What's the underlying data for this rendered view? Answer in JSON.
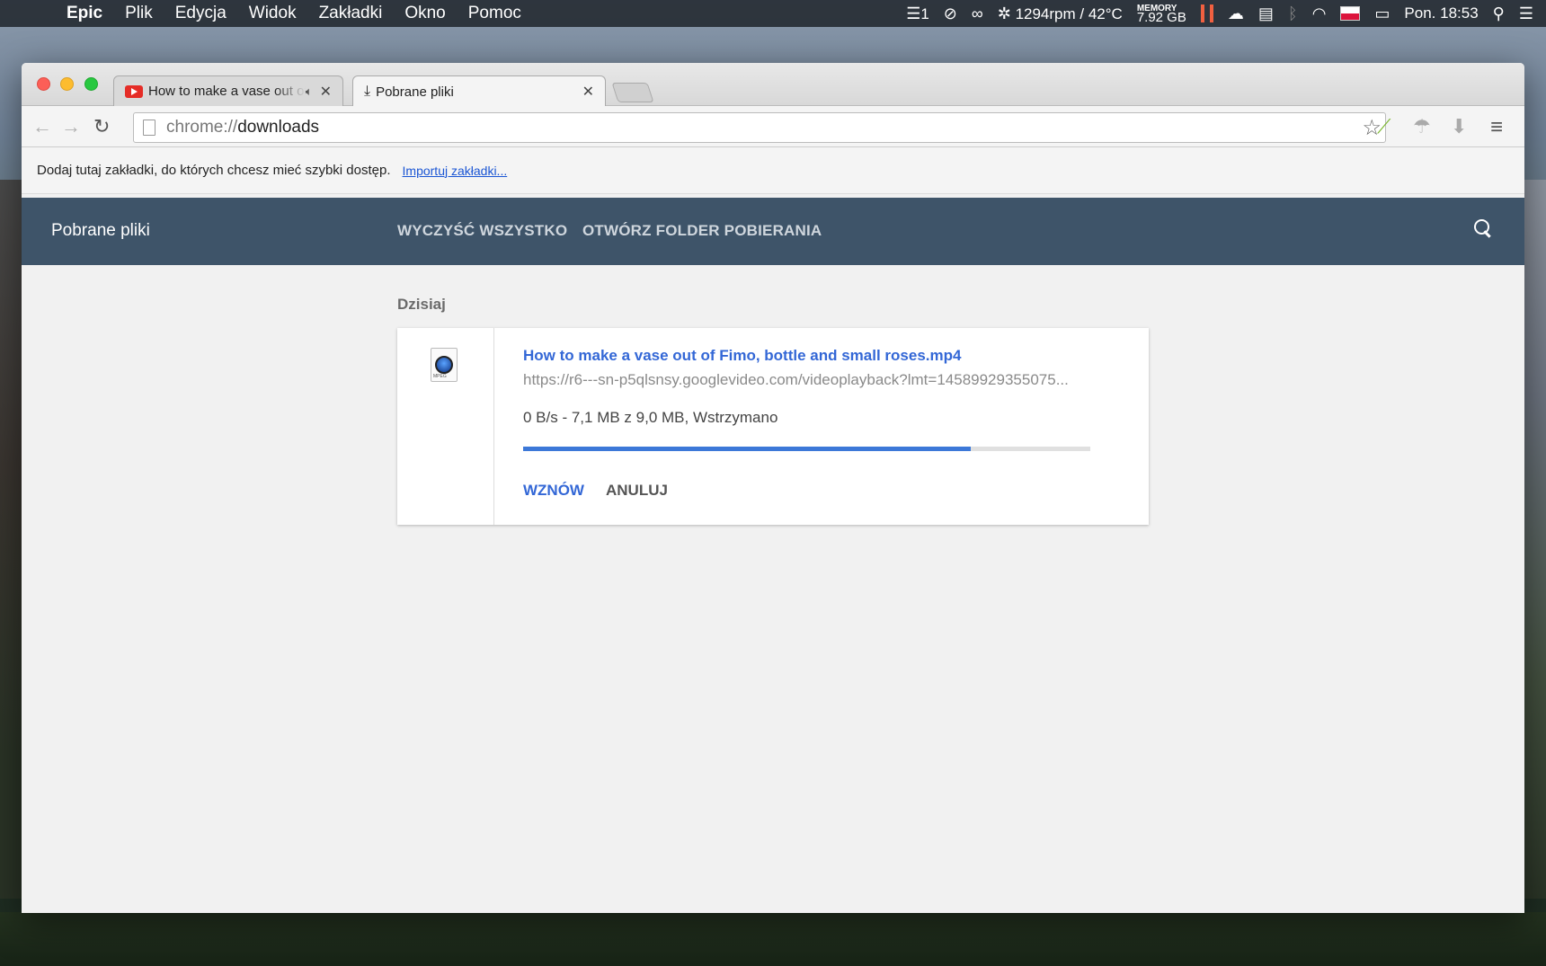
{
  "menubar": {
    "apple_icon": "apple-logo",
    "app_name": "Epic",
    "items": [
      "Plik",
      "Edycja",
      "Widok",
      "Zakładki",
      "Okno",
      "Pomoc"
    ],
    "status": {
      "badge_count": "1",
      "fan_temp": "1294rpm / 42°C",
      "memory_label": "MEMORY",
      "memory_value": "7.92 GB",
      "clock": "Pon. 18:53"
    }
  },
  "tabs": [
    {
      "title": "How to make a vase out of Fimo, bottle and small roses",
      "favicon": "youtube-icon",
      "audio": true
    },
    {
      "title": "Pobrane pliki",
      "favicon": "download-icon",
      "active": true
    }
  ],
  "omnibox": {
    "scheme": "chrome://",
    "host": "downloads"
  },
  "bookmarks_bar": {
    "hint": "Dodaj tutaj zakładki, do których chcesz mieć szybki dostęp.",
    "import_link": "Importuj zakładki..."
  },
  "downloads": {
    "header_title": "Pobrane pliki",
    "clear_all": "WYCZYŚĆ WSZYSTKO",
    "open_folder": "OTWÓRZ FOLDER POBIERANIA",
    "date_group": "Dzisiaj",
    "item": {
      "file_name": "How to make a vase out of Fimo, bottle and small roses.mp4",
      "url": "https://r6---sn-p5qlsnsy.googlevideo.com/videoplayback?lmt=14589929355075...",
      "status": "0 B/s - 7,1 MB z 9,0 MB, Wstrzymano",
      "progress": 0.79,
      "resume": "WZNÓW",
      "cancel": "ANULUJ",
      "file_icon_label": "MPEG"
    }
  },
  "colors": {
    "header_bg": "#3e5469",
    "accent": "#3367d6",
    "progress_fill": "#3c78d8"
  }
}
